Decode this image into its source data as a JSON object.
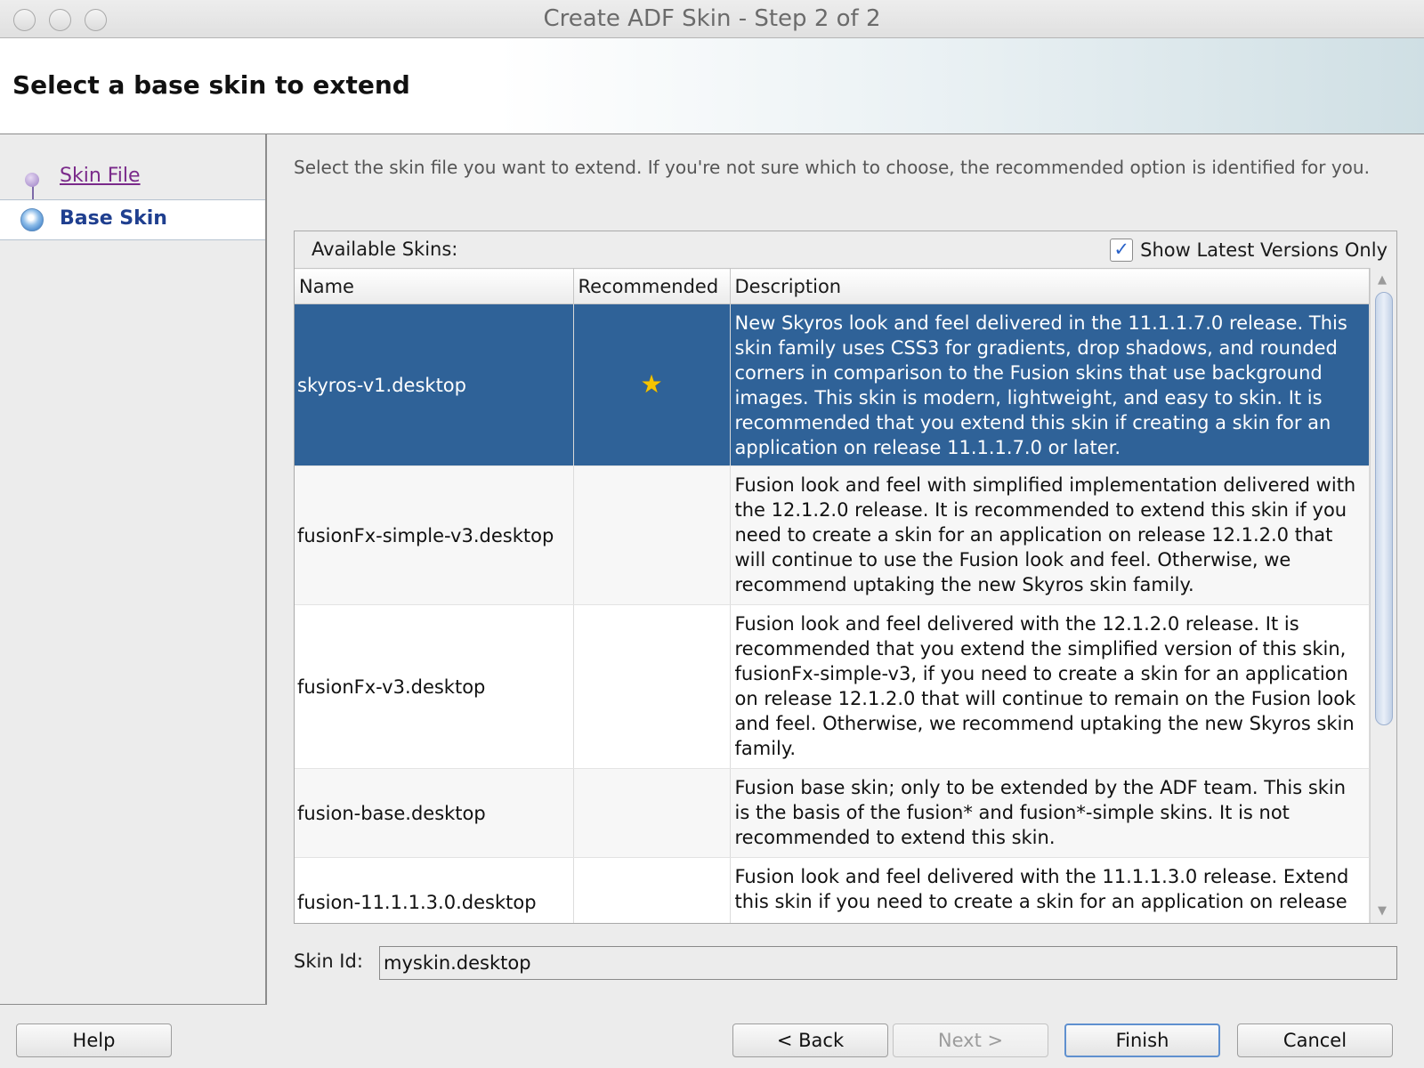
{
  "window": {
    "title": "Create ADF Skin - Step 2 of 2"
  },
  "header": {
    "title": "Select a base skin to extend"
  },
  "nav": {
    "items": [
      {
        "label": "Skin File",
        "state": "visited"
      },
      {
        "label": "Base Skin",
        "state": "current"
      }
    ]
  },
  "content": {
    "intro": "Select the skin file you want to extend. If you're not sure which to choose, the recommended option is identified for you.",
    "panel_label": "Available Skins:",
    "show_latest": {
      "label": "Show Latest Versions Only",
      "checked": true
    },
    "columns": [
      "Name",
      "Recommended",
      "Description"
    ],
    "rows": [
      {
        "name": "skyros-v1.desktop",
        "recommended": "★",
        "selected": true,
        "description": "New Skyros look and feel delivered in the 11.1.1.7.0 release. This skin family uses CSS3 for gradients, drop shadows, and rounded corners in comparison to the Fusion skins that use background images. This skin is modern, lightweight, and easy to skin. It is recommended that you extend this skin if creating a skin for an application on release 11.1.1.7.0 or later."
      },
      {
        "name": "fusionFx-simple-v3.desktop",
        "recommended": "",
        "selected": false,
        "description": "Fusion look and feel with simplified implementation delivered with the 12.1.2.0 release. It is recommended to extend this skin if you need to create a skin for an application on release 12.1.2.0 that will continue to use the Fusion look and feel. Otherwise, we recommend uptaking the new Skyros skin family."
      },
      {
        "name": "fusionFx-v3.desktop",
        "recommended": "",
        "selected": false,
        "description": "Fusion look and feel delivered with the 12.1.2.0 release. It is recommended that you extend the simplified version of this skin, fusionFx-simple-v3, if you need to create a skin for an application on release 12.1.2.0 that will continue to remain on the Fusion look and feel. Otherwise, we recommend uptaking the new Skyros skin family."
      },
      {
        "name": "fusion-base.desktop",
        "recommended": "",
        "selected": false,
        "description": "Fusion base skin; only to be extended by the ADF team. This skin is the basis of the fusion* and fusion*-simple skins. It is not recommended to extend this skin."
      },
      {
        "name": "fusion-11.1.1.3.0.desktop",
        "recommended": "",
        "selected": false,
        "description": "Fusion look and feel delivered with the 11.1.1.3.0 release. Extend this skin if you need to create a skin for an application on release"
      }
    ],
    "skin_id": {
      "label": "Skin Id:",
      "value": "myskin.desktop"
    }
  },
  "buttons": {
    "help": "Help",
    "back": "< Back",
    "next": "Next >",
    "finish": "Finish",
    "cancel": "Cancel"
  },
  "colors": {
    "selected_row": "#2f6298",
    "nav_current": "#1f3f8f",
    "nav_link": "#7a2a8a",
    "checkbox_mark": "#2a62c9"
  },
  "icons": {
    "recommended": "star-icon",
    "window_controls": [
      "close-icon",
      "minimize-icon",
      "zoom-icon"
    ]
  }
}
